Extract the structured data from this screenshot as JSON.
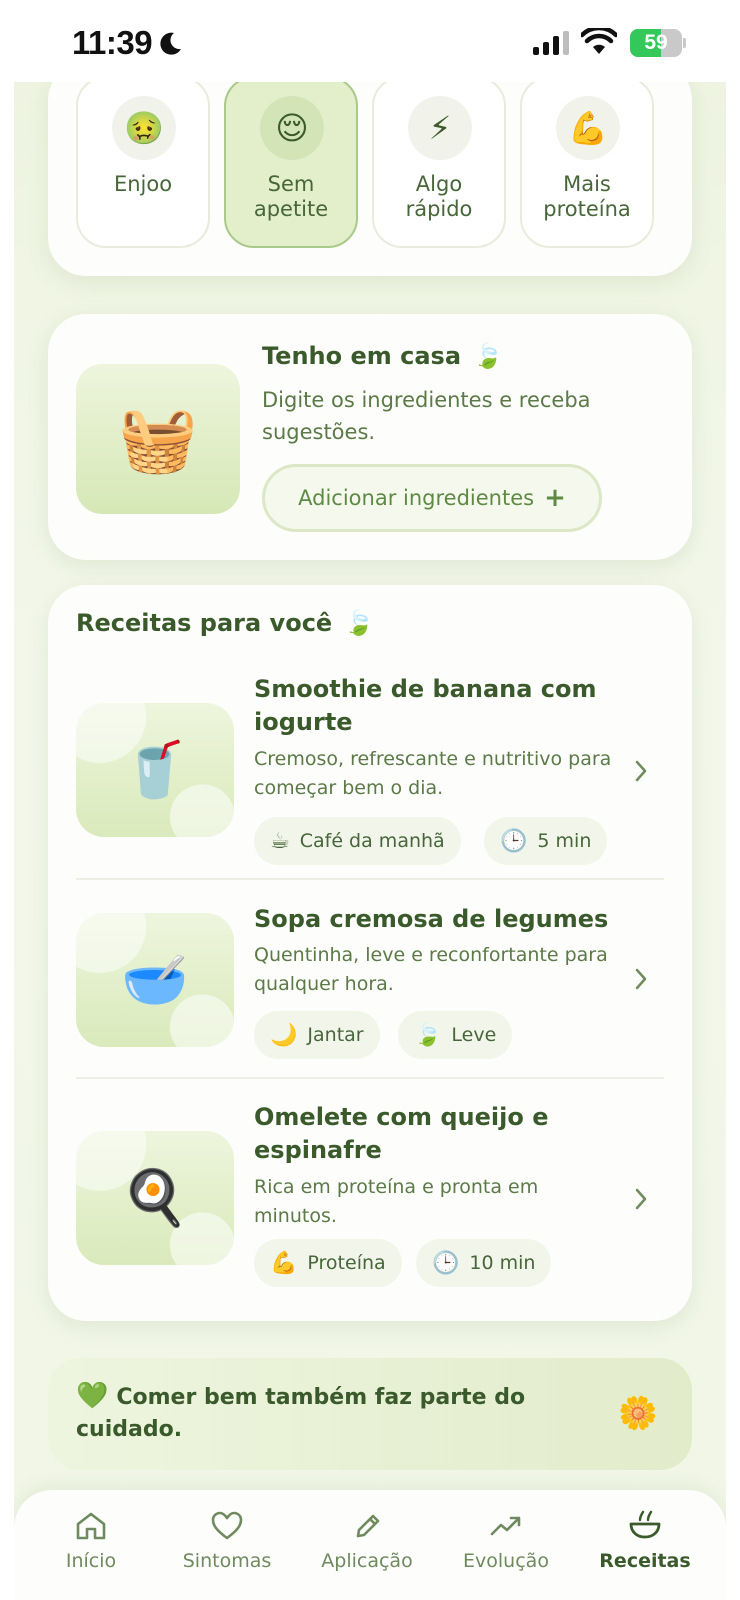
{
  "status_bar": {
    "time": "11:39",
    "battery": "59",
    "battery_level": 0.59,
    "icons": [
      "moon-icon",
      "signal-icon",
      "wifi-icon",
      "battery-icon"
    ]
  },
  "moods": [
    {
      "label": "Enjoo",
      "emoji": "🤢",
      "selected": false
    },
    {
      "label": "Sem\napetite",
      "emoji": "😌",
      "selected": true
    },
    {
      "label": "Algo\nrápido",
      "emoji": "⚡",
      "selected": false
    },
    {
      "label": "Mais\nproteína",
      "emoji": "💪",
      "selected": false
    }
  ],
  "home": {
    "emoji": "🧺",
    "title": "Tenho em casa",
    "title_icon": "🍃",
    "description": "Digite os ingredientes e receba sugestões.",
    "button_label": "Adicionar ingredientes",
    "button_icon": "+"
  },
  "recipes": {
    "title": "Receitas para você",
    "title_icon": "🍃",
    "items": [
      {
        "emoji": "🥤",
        "name": "Smoothie de banana com iogurte",
        "description": "Cremoso, refrescante e nutritivo para começar bem o dia.",
        "tags": [
          {
            "icon": "☕",
            "label": "Café da manhã"
          },
          {
            "icon": "🕒",
            "label": "5 min"
          }
        ]
      },
      {
        "emoji": "🥣",
        "name": "Sopa cremosa de legumes",
        "description": "Quentinha, leve e reconfortante para qualquer hora.",
        "tags": [
          {
            "icon": "🌙",
            "label": "Jantar"
          },
          {
            "icon": "🍃",
            "label": "Leve"
          }
        ]
      },
      {
        "emoji": "🍳",
        "name": "Omelete com queijo e espinafre",
        "description": "Rica em proteína e pronta em minutos.",
        "tags": [
          {
            "icon": "💪",
            "label": "Proteína"
          },
          {
            "icon": "🕒",
            "label": "10 min"
          }
        ]
      }
    ]
  },
  "quote": {
    "icon": "💚",
    "text": "Comer bem também faz parte do cuidado.",
    "decoration": "🌼"
  },
  "nav": {
    "items": [
      {
        "label": "Início",
        "icon": "home-icon"
      },
      {
        "label": "Sintomas",
        "icon": "heart-icon"
      },
      {
        "label": "Aplicação",
        "icon": "pencil-icon"
      },
      {
        "label": "Evolução",
        "icon": "trend-up-icon"
      },
      {
        "label": "Receitas",
        "icon": "bowl-icon"
      }
    ],
    "active": "Receitas"
  },
  "colors": {
    "accent": "#5f8a45",
    "text_dark": "#3b5a2c",
    "background": "#eef4e1",
    "selected_tile": "#e3efcb"
  }
}
